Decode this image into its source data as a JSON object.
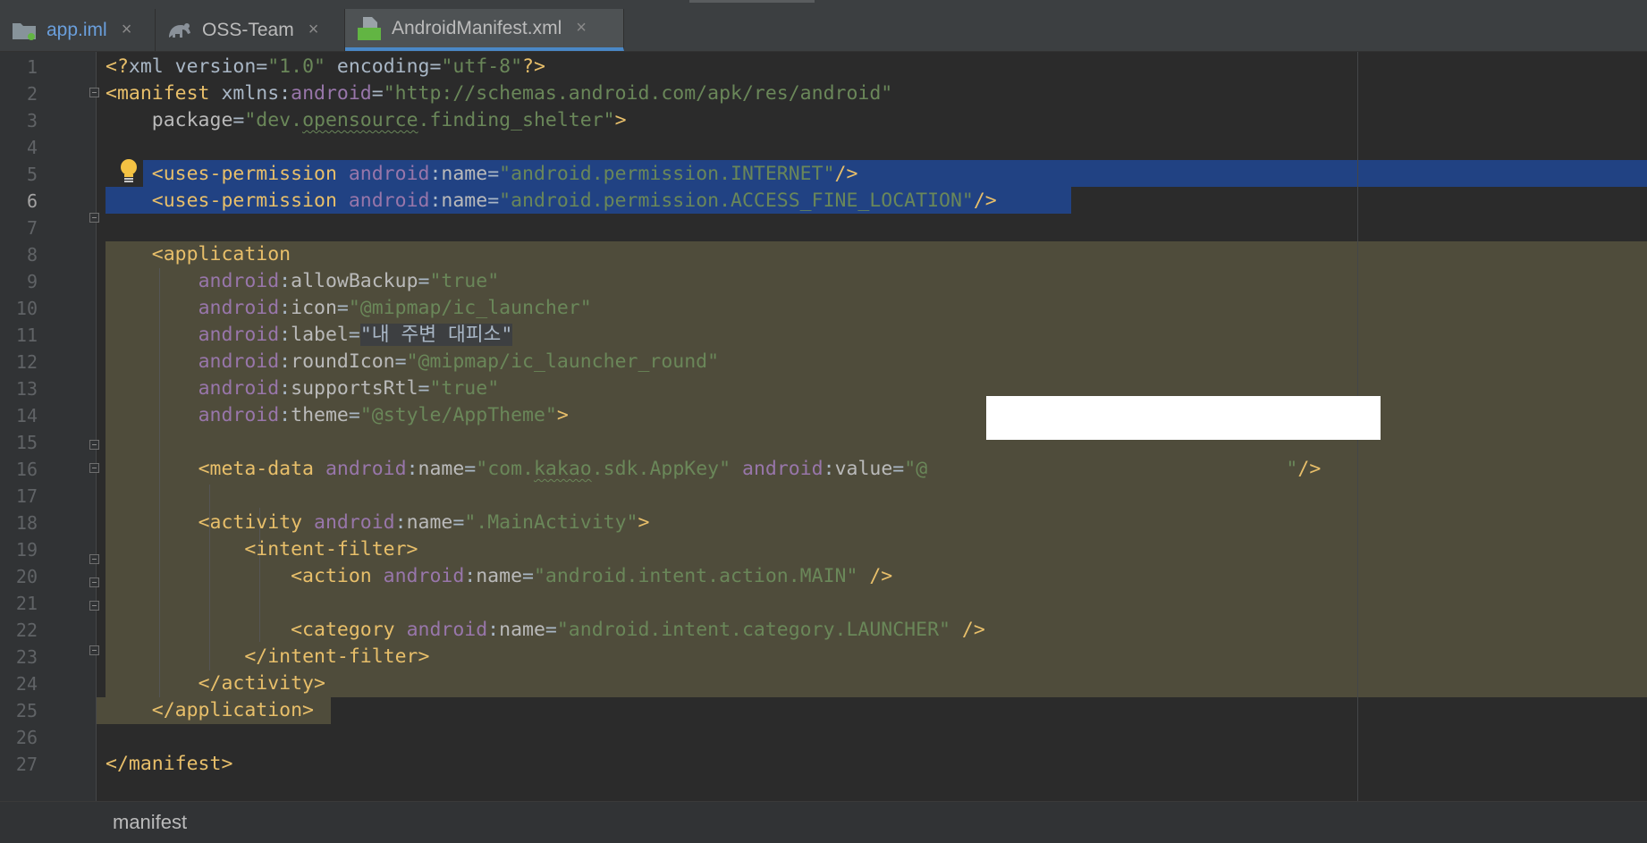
{
  "tabs": [
    {
      "label": "app.iml",
      "icon": "folder-module-icon",
      "close": "×"
    },
    {
      "label": "OSS-Team",
      "icon": "gradle-elephant-icon",
      "close": "×"
    },
    {
      "label": "AndroidManifest.xml",
      "icon": "manifest-file-icon",
      "icon_text": "MF",
      "close": "×",
      "active": true
    }
  ],
  "editor": {
    "lines": [
      {
        "n": "1",
        "tokens": [
          [
            "tg",
            "<?"
          ],
          [
            "pl",
            "xml version="
          ],
          [
            "st",
            "\"1.0\""
          ],
          [
            "pl",
            " encoding="
          ],
          [
            "st",
            "\"utf-8\""
          ],
          [
            "tg",
            "?>"
          ]
        ]
      },
      {
        "n": "2",
        "tokens": [
          [
            "tg",
            "<manifest "
          ],
          [
            "pl",
            "xmlns:"
          ],
          [
            "ns",
            "android"
          ],
          [
            "pl",
            "="
          ],
          [
            "st",
            "\"http://schemas.android.com/apk/res/android\""
          ]
        ]
      },
      {
        "n": "3",
        "tokens": [
          [
            "pl",
            "    "
          ],
          [
            "at",
            "package"
          ],
          [
            "pl",
            "="
          ],
          [
            "st",
            "\"dev."
          ],
          [
            "sq",
            "opensource"
          ],
          [
            "st",
            ".finding_shelter\""
          ],
          [
            "tg",
            ">"
          ]
        ]
      },
      {
        "n": "4",
        "tokens": []
      },
      {
        "n": "5",
        "tokens": [
          [
            "pl",
            "    "
          ],
          [
            "tg",
            "<uses-permission "
          ],
          [
            "ns",
            "android"
          ],
          [
            "pl",
            ":"
          ],
          [
            "at",
            "name"
          ],
          [
            "pl",
            "="
          ],
          [
            "st",
            "\"android.permission.INTERNET\""
          ],
          [
            "tg",
            "/>"
          ]
        ]
      },
      {
        "n": "6",
        "tokens": [
          [
            "pl",
            "    "
          ],
          [
            "tg",
            "<uses-permission "
          ],
          [
            "ns",
            "android"
          ],
          [
            "pl",
            ":"
          ],
          [
            "at",
            "name"
          ],
          [
            "pl",
            "="
          ],
          [
            "st",
            "\"android.permission.ACCESS_FINE_LOCATION\""
          ],
          [
            "tg",
            "/>"
          ]
        ]
      },
      {
        "n": "7",
        "tokens": []
      },
      {
        "n": "8",
        "tokens": [
          [
            "pl",
            "    "
          ],
          [
            "tg",
            "<application"
          ]
        ]
      },
      {
        "n": "9",
        "tokens": [
          [
            "pl",
            "        "
          ],
          [
            "ns",
            "android"
          ],
          [
            "pl",
            ":"
          ],
          [
            "at",
            "allowBackup"
          ],
          [
            "pl",
            "="
          ],
          [
            "st",
            "\"true\""
          ]
        ]
      },
      {
        "n": "10",
        "tokens": [
          [
            "pl",
            "        "
          ],
          [
            "ns",
            "android"
          ],
          [
            "pl",
            ":"
          ],
          [
            "at",
            "icon"
          ],
          [
            "pl",
            "="
          ],
          [
            "st",
            "\"@mipmap/ic_launcher\""
          ]
        ]
      },
      {
        "n": "11",
        "tokens": [
          [
            "pl",
            "        "
          ],
          [
            "ns",
            "android"
          ],
          [
            "pl",
            ":"
          ],
          [
            "at",
            "label"
          ],
          [
            "pl",
            "="
          ],
          [
            "kr",
            "\"내 주변 대피소\""
          ]
        ]
      },
      {
        "n": "12",
        "tokens": [
          [
            "pl",
            "        "
          ],
          [
            "ns",
            "android"
          ],
          [
            "pl",
            ":"
          ],
          [
            "at",
            "roundIcon"
          ],
          [
            "pl",
            "="
          ],
          [
            "st",
            "\"@mipmap/ic_launcher_round\""
          ]
        ]
      },
      {
        "n": "13",
        "tokens": [
          [
            "pl",
            "        "
          ],
          [
            "ns",
            "android"
          ],
          [
            "pl",
            ":"
          ],
          [
            "at",
            "supportsRtl"
          ],
          [
            "pl",
            "="
          ],
          [
            "st",
            "\"true\""
          ]
        ]
      },
      {
        "n": "14",
        "tokens": [
          [
            "pl",
            "        "
          ],
          [
            "ns",
            "android"
          ],
          [
            "pl",
            ":"
          ],
          [
            "at",
            "theme"
          ],
          [
            "pl",
            "="
          ],
          [
            "st",
            "\"@style/AppTheme\""
          ],
          [
            "tg",
            ">"
          ]
        ]
      },
      {
        "n": "15",
        "tokens": []
      },
      {
        "n": "16",
        "tokens": [
          [
            "pl",
            "        "
          ],
          [
            "tg",
            "<meta-data "
          ],
          [
            "ns",
            "android"
          ],
          [
            "pl",
            ":"
          ],
          [
            "at",
            "name"
          ],
          [
            "pl",
            "="
          ],
          [
            "st",
            "\"com."
          ],
          [
            "sq",
            "kakao"
          ],
          [
            "st",
            ".sdk.AppKey\" "
          ],
          [
            "ns",
            "android"
          ],
          [
            "pl",
            ":"
          ],
          [
            "at",
            "value"
          ],
          [
            "pl",
            "="
          ],
          [
            "st",
            "\"@"
          ],
          [
            "pl",
            "                               "
          ],
          [
            "st",
            "\""
          ],
          [
            "tg",
            "/>"
          ]
        ]
      },
      {
        "n": "17",
        "tokens": []
      },
      {
        "n": "18",
        "tokens": [
          [
            "pl",
            "        "
          ],
          [
            "tg",
            "<activity "
          ],
          [
            "ns",
            "android"
          ],
          [
            "pl",
            ":"
          ],
          [
            "at",
            "name"
          ],
          [
            "pl",
            "="
          ],
          [
            "st",
            "\".MainActivity\""
          ],
          [
            "tg",
            ">"
          ]
        ]
      },
      {
        "n": "19",
        "tokens": [
          [
            "pl",
            "            "
          ],
          [
            "tg",
            "<intent-filter>"
          ]
        ]
      },
      {
        "n": "20",
        "tokens": [
          [
            "pl",
            "                "
          ],
          [
            "tg",
            "<action "
          ],
          [
            "ns",
            "android"
          ],
          [
            "pl",
            ":"
          ],
          [
            "at",
            "name"
          ],
          [
            "pl",
            "="
          ],
          [
            "st",
            "\"android.intent.action.MAIN\""
          ],
          [
            "tg",
            " />"
          ]
        ]
      },
      {
        "n": "21",
        "tokens": []
      },
      {
        "n": "22",
        "tokens": [
          [
            "pl",
            "                "
          ],
          [
            "tg",
            "<category "
          ],
          [
            "ns",
            "android"
          ],
          [
            "pl",
            ":"
          ],
          [
            "at",
            "name"
          ],
          [
            "pl",
            "="
          ],
          [
            "st",
            "\"android.intent.category.LAUNCHER\""
          ],
          [
            "tg",
            " />"
          ]
        ]
      },
      {
        "n": "23",
        "tokens": [
          [
            "pl",
            "            "
          ],
          [
            "tg",
            "</intent-filter>"
          ]
        ]
      },
      {
        "n": "24",
        "tokens": [
          [
            "pl",
            "        "
          ],
          [
            "tg",
            "</activity>"
          ]
        ]
      },
      {
        "n": "25",
        "tokens": [
          [
            "pl",
            "    "
          ],
          [
            "tg",
            "</application>"
          ]
        ]
      },
      {
        "n": "26",
        "tokens": []
      },
      {
        "n": "27",
        "tokens": [
          [
            "tg",
            "</manifest>"
          ]
        ]
      }
    ],
    "current_line": "6",
    "intention_icon": "lightbulb-icon"
  },
  "statusbar": {
    "breadcrumb": "manifest"
  },
  "colors": {
    "background": "#2b2b2b",
    "gutter": "#313335",
    "selection": "#214283",
    "identifier_highlight": "#4f4c3b",
    "tag": "#e8bf6a",
    "namespace": "#9876aa",
    "attribute": "#bababa",
    "string": "#6a8759",
    "active_tab_underline": "#4a88c7"
  }
}
